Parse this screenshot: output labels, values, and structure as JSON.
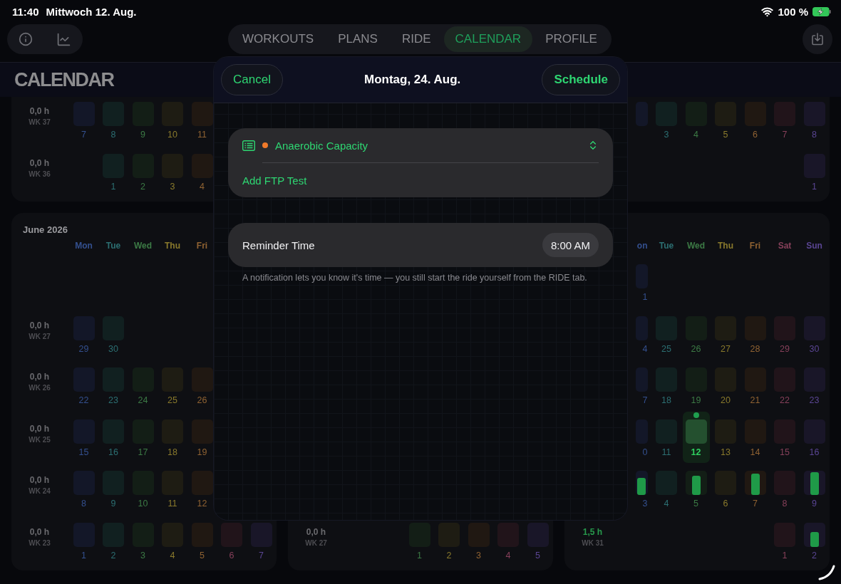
{
  "status_bar": {
    "time": "11:40",
    "date": "Mittwoch 12. Aug.",
    "battery": "100 %"
  },
  "tabs": [
    {
      "label": "WORKOUTS",
      "selected": false
    },
    {
      "label": "PLANS",
      "selected": false
    },
    {
      "label": "RIDE",
      "selected": false
    },
    {
      "label": "CALENDAR",
      "selected": true
    },
    {
      "label": "PROFILE",
      "selected": false
    }
  ],
  "page_title": "CALENDAR",
  "calendar": {
    "top_row": {
      "left": {
        "weeks": [
          {
            "hours": "0,0 h",
            "week": "WK 37",
            "active": false,
            "days": {
              "mon": {
                "day": "7",
                "today": false
              },
              "tue": {
                "day": "8",
                "today": false
              },
              "wed": {
                "day": "9",
                "today": false
              },
              "thu": {
                "day": "10",
                "today": false
              },
              "fri": {
                "day": "11",
                "today": false
              }
            }
          },
          {
            "hours": "0,0 h",
            "week": "WK 36",
            "active": false,
            "days": {
              "tue": {
                "day": "1",
                "today": false
              },
              "wed": {
                "day": "2",
                "today": false
              },
              "thu": {
                "day": "3",
                "today": false
              },
              "fri": {
                "day": "4",
                "today": false
              }
            }
          }
        ]
      },
      "right": {
        "weeks": [
          {
            "days": {
              "mon": {
                "today": false
              },
              "tue": {
                "day": "3",
                "today": false
              },
              "wed": {
                "day": "4",
                "today": false
              },
              "thu": {
                "day": "5",
                "today": false
              },
              "fri": {
                "day": "6",
                "today": false
              },
              "sat": {
                "day": "7",
                "today": false
              },
              "sun": {
                "day": "8",
                "today": false
              }
            }
          },
          {
            "days": {
              "sun": {
                "day": "1",
                "today": false
              }
            }
          }
        ]
      }
    },
    "bottom_row": {
      "left": {
        "title": "June 2026",
        "weekdays": {
          "mon": "Mon",
          "tue": "Tue",
          "wed": "Wed",
          "thu": "Thu",
          "fri": "Fri"
        },
        "weeks": [
          {
            "hours": "0,0 h",
            "week": "WK 27",
            "active": false,
            "days": {
              "mon": {
                "day": "29",
                "today": false
              },
              "tue": {
                "day": "30",
                "today": false
              }
            }
          },
          {
            "hours": "0,0 h",
            "week": "WK 26",
            "active": false,
            "days": {
              "mon": {
                "day": "22",
                "today": false
              },
              "tue": {
                "day": "23",
                "today": false
              },
              "wed": {
                "day": "24",
                "today": false
              },
              "thu": {
                "day": "25",
                "today": false
              },
              "fri": {
                "day": "26",
                "today": false
              }
            }
          },
          {
            "hours": "0,0 h",
            "week": "WK 25",
            "active": false,
            "days": {
              "mon": {
                "day": "15",
                "today": false
              },
              "tue": {
                "day": "16",
                "today": false
              },
              "wed": {
                "day": "17",
                "today": false
              },
              "thu": {
                "day": "18",
                "today": false
              },
              "fri": {
                "day": "19",
                "today": false
              }
            }
          },
          {
            "hours": "0,0 h",
            "week": "WK 24",
            "active": false,
            "days": {
              "mon": {
                "day": "8",
                "today": false
              },
              "tue": {
                "day": "9",
                "today": false
              },
              "wed": {
                "day": "10",
                "today": false
              },
              "thu": {
                "day": "11",
                "today": false
              },
              "fri": {
                "day": "12",
                "today": false
              }
            }
          },
          {
            "hours": "0,0 h",
            "week": "WK 23",
            "active": false,
            "days": {
              "mon": {
                "day": "1",
                "today": false
              },
              "tue": {
                "day": "2",
                "today": false
              },
              "wed": {
                "day": "3",
                "today": false
              },
              "thu": {
                "day": "4",
                "today": false
              },
              "fri": {
                "day": "5",
                "today": false
              },
              "sat": {
                "day": "6",
                "today": false
              },
              "sun": {
                "day": "7",
                "today": false
              }
            }
          }
        ]
      },
      "middle": {
        "weeks": [
          {
            "hours": "0,0 h",
            "week": "WK 27",
            "active": false,
            "days": {
              "wed": {
                "day": "1",
                "today": false
              },
              "thu": {
                "day": "2",
                "today": false
              },
              "fri": {
                "day": "3",
                "today": false
              },
              "sat": {
                "day": "4",
                "today": false
              },
              "sun": {
                "day": "5",
                "today": false
              }
            }
          }
        ]
      },
      "right": {
        "weekdays": {
          "mon": "on",
          "tue": "Tue",
          "wed": "Wed",
          "thu": "Thu",
          "fri": "Fri",
          "sat": "Sat",
          "sun": "Sun"
        },
        "weeks": [
          {
            "days": {
              "mon": {
                "day": "1",
                "today": false
              }
            }
          },
          {
            "days": {
              "mon": {
                "day": "4",
                "today": false
              },
              "tue": {
                "day": "25",
                "today": false
              },
              "wed": {
                "day": "26",
                "today": false
              },
              "thu": {
                "day": "27",
                "today": false
              },
              "fri": {
                "day": "28",
                "today": false
              },
              "sat": {
                "day": "29",
                "today": false
              },
              "sun": {
                "day": "30",
                "today": false
              }
            }
          },
          {
            "days": {
              "mon": {
                "day": "7",
                "today": false
              },
              "tue": {
                "day": "18",
                "today": false
              },
              "wed": {
                "day": "19",
                "today": false
              },
              "thu": {
                "day": "20",
                "today": false
              },
              "fri": {
                "day": "21",
                "today": false
              },
              "sat": {
                "day": "22",
                "today": false
              },
              "sun": {
                "day": "23",
                "today": false
              }
            }
          },
          {
            "days": {
              "mon": {
                "day": "0",
                "today": false
              },
              "tue": {
                "day": "11",
                "today": false
              },
              "wed": {
                "day": "12",
                "today": true
              },
              "thu": {
                "day": "13",
                "today": false
              },
              "fri": {
                "day": "14",
                "today": false
              },
              "sat": {
                "day": "15",
                "today": false
              },
              "sun": {
                "day": "16",
                "today": false
              }
            }
          },
          {
            "days": {
              "mon": {
                "day": "3",
                "today": false,
                "level": 0.7
              },
              "tue": {
                "day": "4",
                "today": false
              },
              "wed": {
                "day": "5",
                "today": false,
                "level": 0.8
              },
              "thu": {
                "day": "6",
                "today": false
              },
              "fri": {
                "day": "7",
                "today": false,
                "level": 0.88
              },
              "sat": {
                "day": "8",
                "today": false
              },
              "sun": {
                "day": "9",
                "today": false,
                "level": 0.94
              }
            }
          },
          {
            "hours": "1,5 h",
            "week": "WK 31",
            "active": true,
            "days": {
              "sat": {
                "day": "1",
                "today": false
              },
              "sun": {
                "day": "2",
                "today": false,
                "level": 0.6
              }
            }
          }
        ]
      }
    }
  },
  "sheet": {
    "title": "Montag, 24. Aug.",
    "cancel": "Cancel",
    "schedule": "Schedule",
    "workout": "Anaerobic Capacity",
    "add": "Add FTP Test",
    "reminder_label": "Reminder Time",
    "reminder_time": "8:00 AM",
    "note": "A notification lets you know it's time — you still start the ride yourself from the RIDE tab."
  }
}
